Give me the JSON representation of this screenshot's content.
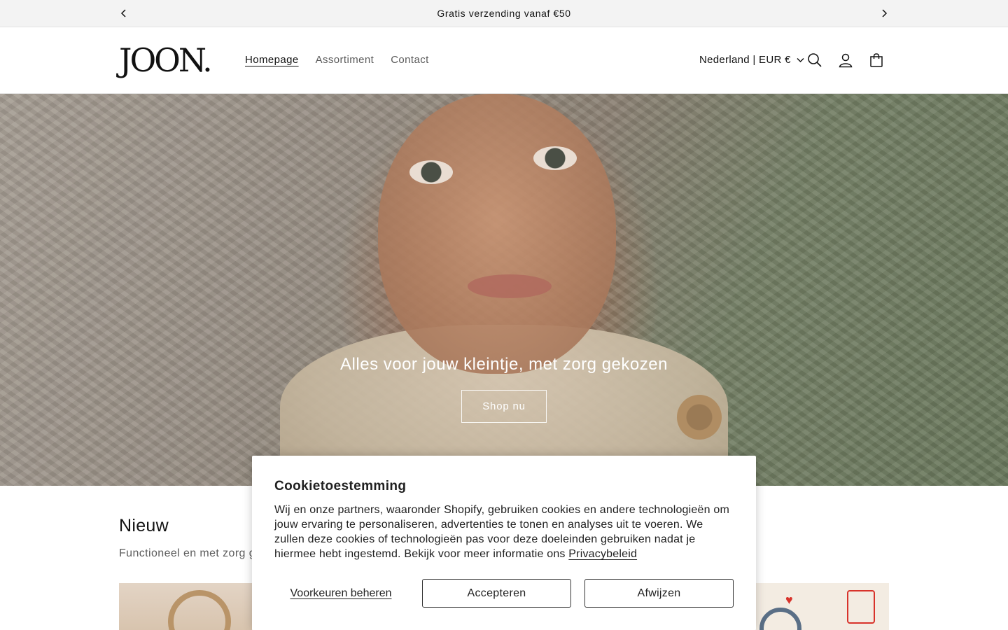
{
  "announcement": {
    "text": "Gratis verzending vanaf €50",
    "prev_icon": "chevron-left-icon",
    "next_icon": "chevron-right-icon"
  },
  "header": {
    "logo": "JOON.",
    "nav": [
      {
        "label": "Homepage",
        "active": true
      },
      {
        "label": "Assortiment",
        "active": false
      },
      {
        "label": "Contact",
        "active": false
      }
    ],
    "country_selector": "Nederland | EUR €",
    "icons": [
      "search-icon",
      "account-icon",
      "cart-icon"
    ]
  },
  "hero": {
    "title": "Alles voor jouw kleintje, met zorg gekozen",
    "button_label": "Shop nu"
  },
  "featured": {
    "title": "Nieuw",
    "subtitle": "Functioneel en met zorg ge"
  },
  "cookie_banner": {
    "title": "Cookietoestemming",
    "body": "Wij en onze partners, waaronder Shopify, gebruiken cookies en andere technologieën om jouw ervaring te personaliseren, advertenties te tonen en analyses uit te voeren. We zullen deze cookies of technologieën pas voor deze doeleinden gebruiken nadat je hiermee hebt ingestemd. Bekijk voor meer informatie ons",
    "privacy_link": "Privacybeleid",
    "manage_label": "Voorkeuren beheren",
    "accept_label": "Accepteren",
    "decline_label": "Afwijzen"
  },
  "colors": {
    "text": "#121212",
    "muted": "#5a5a5a",
    "announcement_bg": "#f3f3f3",
    "button_border": "#333333"
  }
}
